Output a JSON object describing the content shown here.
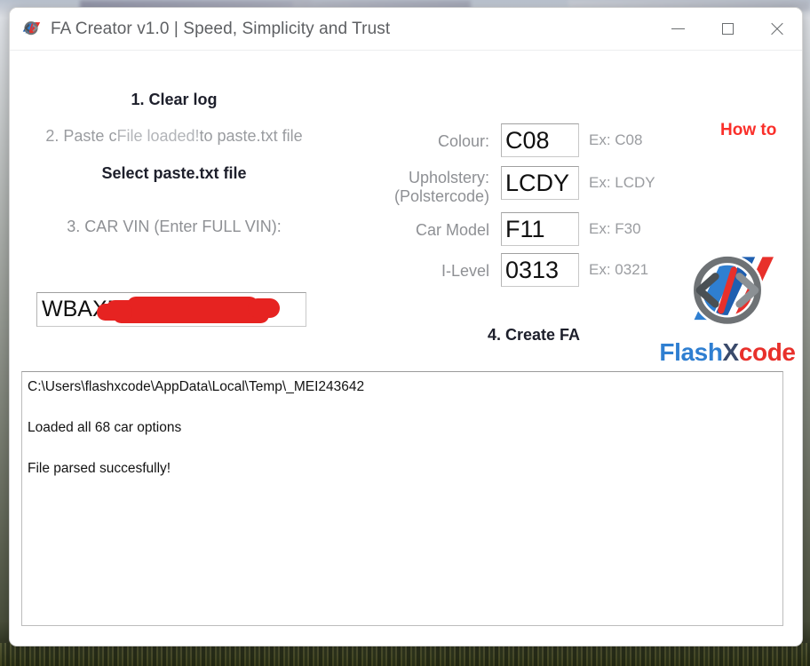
{
  "window": {
    "title": "FA Creator v1.0 | Speed, Simplicity and Trust",
    "icon": "flashxcode-logo-icon",
    "controls": {
      "minimize_label": "minimize",
      "maximize_label": "maximize",
      "close_label": "close"
    }
  },
  "steps": {
    "clear_log": "1. Clear log",
    "paste_prefix": "2. Paste c",
    "file_loaded_badge": "File loaded!",
    "paste_suffix": "to paste.txt file",
    "select_file": "Select paste.txt file",
    "vin_label": "3. CAR VIN (Enter FULL VIN):",
    "create_fa": "4. Create FA"
  },
  "vin": {
    "value": "WBAXB",
    "placeholder": "Enter FULL VIN",
    "redacted": true
  },
  "fields": [
    {
      "key": "colour",
      "label": "Colour:",
      "value": "C08",
      "hint": "Ex: C08",
      "placeholder": "C08"
    },
    {
      "key": "upholstery",
      "label": "Upholstery:\n(Polstercode)",
      "value": "LCDY",
      "hint": "Ex: LCDY",
      "placeholder": "LCDY"
    },
    {
      "key": "car_model",
      "label": "Car Model",
      "value": "F11",
      "hint": "Ex: F30",
      "placeholder": "F30"
    },
    {
      "key": "i_level",
      "label": "I-Level",
      "value": "0313",
      "hint": "Ex: 0321",
      "placeholder": "0321"
    }
  ],
  "field_labels": {
    "colour": "Colour:",
    "upholstery_line1": "Upholstery:",
    "upholstery_line2": "(Polstercode)",
    "car_model": "Car Model",
    "i_level": "I-Level"
  },
  "field_values": {
    "colour": "C08",
    "upholstery": "LCDY",
    "car_model": "F11",
    "i_level": "0313"
  },
  "field_hints": {
    "colour": "Ex: C08",
    "upholstery": "Ex: LCDY",
    "car_model": "Ex: F30",
    "i_level": "Ex: 0321"
  },
  "help": {
    "how_to": "How to"
  },
  "brand": {
    "name_part1": "Flash",
    "name_part2": "X",
    "name_part3": "code",
    "logo_icon": "code-brackets-circle-icon",
    "blue": "#2f7fd1",
    "red": "#e8302b",
    "dark": "#3a4a6b"
  },
  "log": {
    "lines": [
      "C:\\Users\\flashxcode\\AppData\\Local\\Temp\\_MEI243642",
      "Loaded all 68 car options",
      "File parsed succesfully!"
    ]
  },
  "colors": {
    "accent_red": "#fa2f2a",
    "label_gray": "#8e9094",
    "text_dark": "#1d1f2b",
    "redaction": "#e62321"
  }
}
